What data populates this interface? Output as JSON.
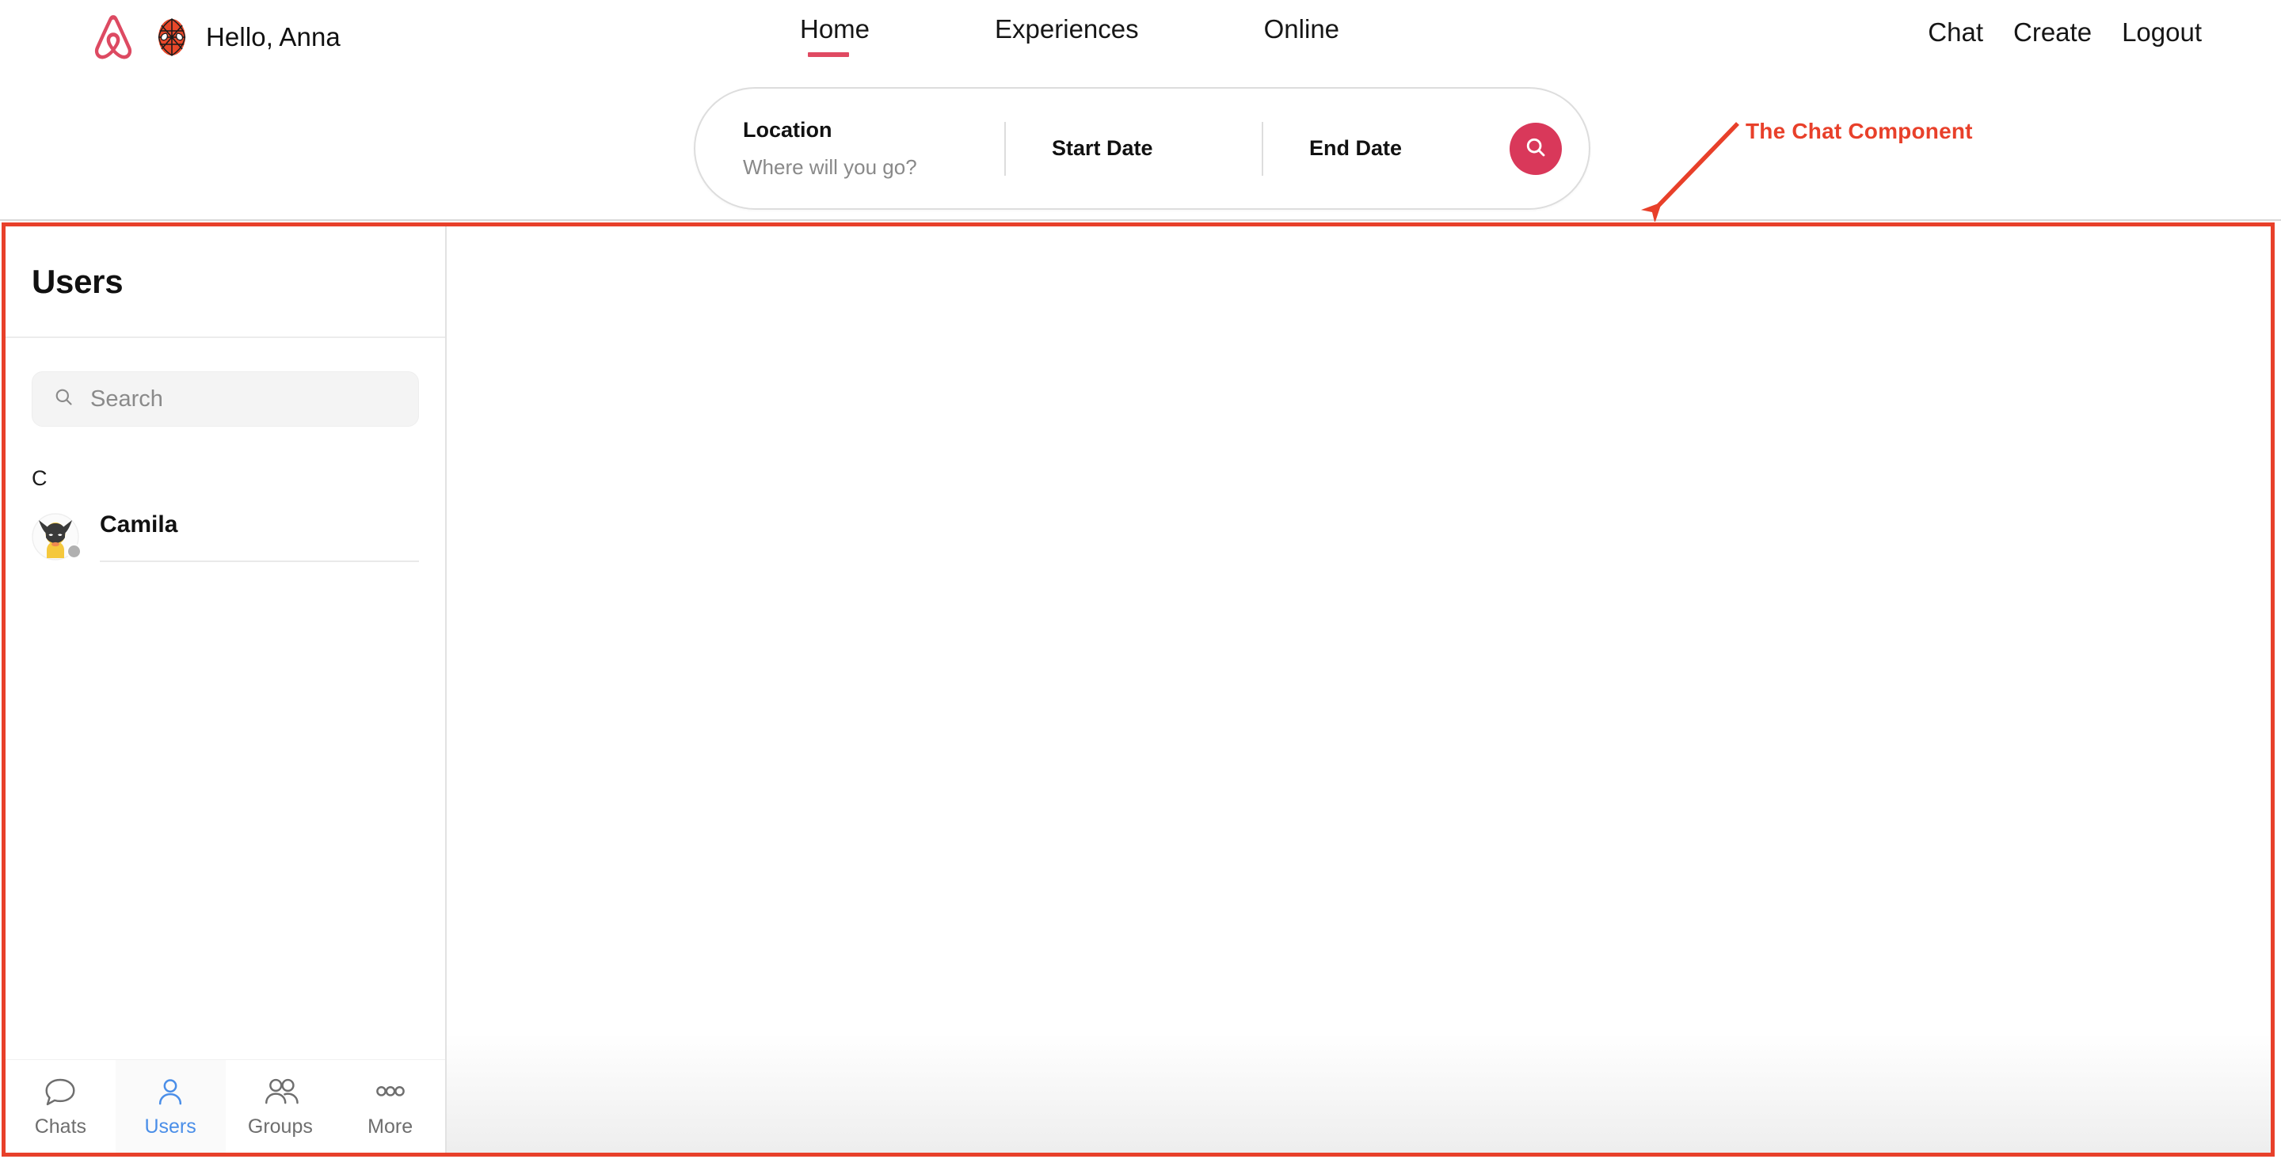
{
  "header": {
    "logo_icon": "airbnb-belo-logo",
    "avatar_icon": "spiderman-avatar",
    "greeting": "Hello, Anna",
    "tabs": [
      {
        "label": "Home",
        "active": true
      },
      {
        "label": "Experiences",
        "active": false
      },
      {
        "label": "Online",
        "active": false
      }
    ],
    "links": [
      {
        "label": "Chat"
      },
      {
        "label": "Create"
      },
      {
        "label": "Logout"
      }
    ],
    "active_tab_underline_color": "#e04a62"
  },
  "search_bar": {
    "location_label": "Location",
    "location_placeholder": "Where will you go?",
    "start_date_label": "Start Date",
    "start_date_value": "",
    "end_date_label": "End Date",
    "end_date_value": "",
    "search_icon": "search-icon",
    "search_button_color": "#d9385a"
  },
  "annotation": {
    "text": "The Chat Component",
    "color": "#e8402a"
  },
  "chat_component": {
    "border_color": "#e8402a",
    "sidebar": {
      "title": "Users",
      "search_placeholder": "Search",
      "search_icon": "search-icon",
      "groups": [
        {
          "letter": "C",
          "users": [
            {
              "name": "Camila",
              "avatar_icon": "wolverine-avatar",
              "status": "offline",
              "status_color": "#b0b0b0"
            }
          ]
        }
      ],
      "tabs": [
        {
          "label": "Chats",
          "icon": "chat-bubble-icon",
          "active": false
        },
        {
          "label": "Users",
          "icon": "person-icon",
          "active": true
        },
        {
          "label": "Groups",
          "icon": "people-icon",
          "active": false
        },
        {
          "label": "More",
          "icon": "ellipsis-icon",
          "active": false
        }
      ],
      "active_tab_color": "#4a8ee8"
    },
    "conversation_panel": {
      "empty_state_text": ""
    }
  }
}
